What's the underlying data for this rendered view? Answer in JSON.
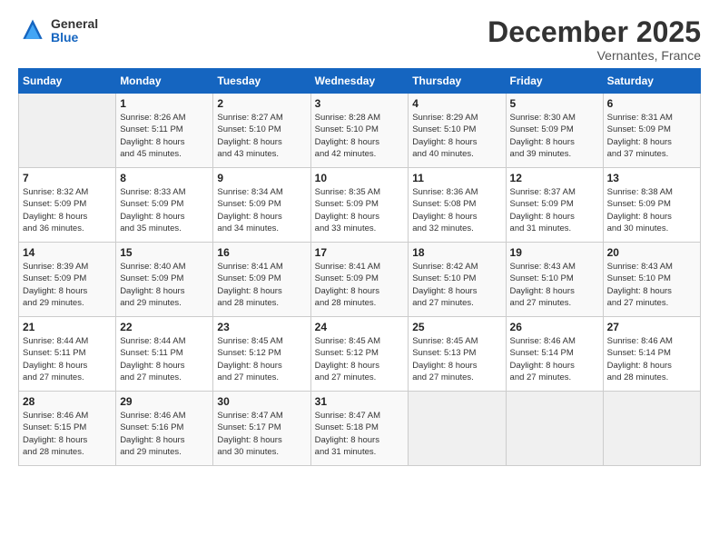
{
  "header": {
    "logo_general": "General",
    "logo_blue": "Blue",
    "month_year": "December 2025",
    "location": "Vernantes, France"
  },
  "days_of_week": [
    "Sunday",
    "Monday",
    "Tuesday",
    "Wednesday",
    "Thursday",
    "Friday",
    "Saturday"
  ],
  "weeks": [
    [
      {
        "day": "",
        "sunrise": "",
        "sunset": "",
        "daylight": ""
      },
      {
        "day": "1",
        "sunrise": "Sunrise: 8:26 AM",
        "sunset": "Sunset: 5:11 PM",
        "daylight": "Daylight: 8 hours and 45 minutes."
      },
      {
        "day": "2",
        "sunrise": "Sunrise: 8:27 AM",
        "sunset": "Sunset: 5:10 PM",
        "daylight": "Daylight: 8 hours and 43 minutes."
      },
      {
        "day": "3",
        "sunrise": "Sunrise: 8:28 AM",
        "sunset": "Sunset: 5:10 PM",
        "daylight": "Daylight: 8 hours and 42 minutes."
      },
      {
        "day": "4",
        "sunrise": "Sunrise: 8:29 AM",
        "sunset": "Sunset: 5:10 PM",
        "daylight": "Daylight: 8 hours and 40 minutes."
      },
      {
        "day": "5",
        "sunrise": "Sunrise: 8:30 AM",
        "sunset": "Sunset: 5:09 PM",
        "daylight": "Daylight: 8 hours and 39 minutes."
      },
      {
        "day": "6",
        "sunrise": "Sunrise: 8:31 AM",
        "sunset": "Sunset: 5:09 PM",
        "daylight": "Daylight: 8 hours and 37 minutes."
      }
    ],
    [
      {
        "day": "7",
        "sunrise": "Sunrise: 8:32 AM",
        "sunset": "Sunset: 5:09 PM",
        "daylight": "Daylight: 8 hours and 36 minutes."
      },
      {
        "day": "8",
        "sunrise": "Sunrise: 8:33 AM",
        "sunset": "Sunset: 5:09 PM",
        "daylight": "Daylight: 8 hours and 35 minutes."
      },
      {
        "day": "9",
        "sunrise": "Sunrise: 8:34 AM",
        "sunset": "Sunset: 5:09 PM",
        "daylight": "Daylight: 8 hours and 34 minutes."
      },
      {
        "day": "10",
        "sunrise": "Sunrise: 8:35 AM",
        "sunset": "Sunset: 5:09 PM",
        "daylight": "Daylight: 8 hours and 33 minutes."
      },
      {
        "day": "11",
        "sunrise": "Sunrise: 8:36 AM",
        "sunset": "Sunset: 5:08 PM",
        "daylight": "Daylight: 8 hours and 32 minutes."
      },
      {
        "day": "12",
        "sunrise": "Sunrise: 8:37 AM",
        "sunset": "Sunset: 5:09 PM",
        "daylight": "Daylight: 8 hours and 31 minutes."
      },
      {
        "day": "13",
        "sunrise": "Sunrise: 8:38 AM",
        "sunset": "Sunset: 5:09 PM",
        "daylight": "Daylight: 8 hours and 30 minutes."
      }
    ],
    [
      {
        "day": "14",
        "sunrise": "Sunrise: 8:39 AM",
        "sunset": "Sunset: 5:09 PM",
        "daylight": "Daylight: 8 hours and 29 minutes."
      },
      {
        "day": "15",
        "sunrise": "Sunrise: 8:40 AM",
        "sunset": "Sunset: 5:09 PM",
        "daylight": "Daylight: 8 hours and 29 minutes."
      },
      {
        "day": "16",
        "sunrise": "Sunrise: 8:41 AM",
        "sunset": "Sunset: 5:09 PM",
        "daylight": "Daylight: 8 hours and 28 minutes."
      },
      {
        "day": "17",
        "sunrise": "Sunrise: 8:41 AM",
        "sunset": "Sunset: 5:09 PM",
        "daylight": "Daylight: 8 hours and 28 minutes."
      },
      {
        "day": "18",
        "sunrise": "Sunrise: 8:42 AM",
        "sunset": "Sunset: 5:10 PM",
        "daylight": "Daylight: 8 hours and 27 minutes."
      },
      {
        "day": "19",
        "sunrise": "Sunrise: 8:43 AM",
        "sunset": "Sunset: 5:10 PM",
        "daylight": "Daylight: 8 hours and 27 minutes."
      },
      {
        "day": "20",
        "sunrise": "Sunrise: 8:43 AM",
        "sunset": "Sunset: 5:10 PM",
        "daylight": "Daylight: 8 hours and 27 minutes."
      }
    ],
    [
      {
        "day": "21",
        "sunrise": "Sunrise: 8:44 AM",
        "sunset": "Sunset: 5:11 PM",
        "daylight": "Daylight: 8 hours and 27 minutes."
      },
      {
        "day": "22",
        "sunrise": "Sunrise: 8:44 AM",
        "sunset": "Sunset: 5:11 PM",
        "daylight": "Daylight: 8 hours and 27 minutes."
      },
      {
        "day": "23",
        "sunrise": "Sunrise: 8:45 AM",
        "sunset": "Sunset: 5:12 PM",
        "daylight": "Daylight: 8 hours and 27 minutes."
      },
      {
        "day": "24",
        "sunrise": "Sunrise: 8:45 AM",
        "sunset": "Sunset: 5:12 PM",
        "daylight": "Daylight: 8 hours and 27 minutes."
      },
      {
        "day": "25",
        "sunrise": "Sunrise: 8:45 AM",
        "sunset": "Sunset: 5:13 PM",
        "daylight": "Daylight: 8 hours and 27 minutes."
      },
      {
        "day": "26",
        "sunrise": "Sunrise: 8:46 AM",
        "sunset": "Sunset: 5:14 PM",
        "daylight": "Daylight: 8 hours and 27 minutes."
      },
      {
        "day": "27",
        "sunrise": "Sunrise: 8:46 AM",
        "sunset": "Sunset: 5:14 PM",
        "daylight": "Daylight: 8 hours and 28 minutes."
      }
    ],
    [
      {
        "day": "28",
        "sunrise": "Sunrise: 8:46 AM",
        "sunset": "Sunset: 5:15 PM",
        "daylight": "Daylight: 8 hours and 28 minutes."
      },
      {
        "day": "29",
        "sunrise": "Sunrise: 8:46 AM",
        "sunset": "Sunset: 5:16 PM",
        "daylight": "Daylight: 8 hours and 29 minutes."
      },
      {
        "day": "30",
        "sunrise": "Sunrise: 8:47 AM",
        "sunset": "Sunset: 5:17 PM",
        "daylight": "Daylight: 8 hours and 30 minutes."
      },
      {
        "day": "31",
        "sunrise": "Sunrise: 8:47 AM",
        "sunset": "Sunset: 5:18 PM",
        "daylight": "Daylight: 8 hours and 31 minutes."
      },
      {
        "day": "",
        "sunrise": "",
        "sunset": "",
        "daylight": ""
      },
      {
        "day": "",
        "sunrise": "",
        "sunset": "",
        "daylight": ""
      },
      {
        "day": "",
        "sunrise": "",
        "sunset": "",
        "daylight": ""
      }
    ]
  ]
}
